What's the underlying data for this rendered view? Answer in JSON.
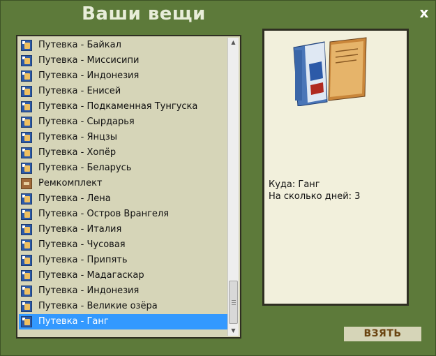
{
  "window": {
    "title": "Ваши вещи",
    "close_label": "x"
  },
  "items": [
    {
      "label": "Путевка - Байкал",
      "icon": "voucher-icon"
    },
    {
      "label": "Путевка - Миссисипи",
      "icon": "voucher-icon"
    },
    {
      "label": "Путевка - Индонезия",
      "icon": "voucher-icon"
    },
    {
      "label": "Путевка - Енисей",
      "icon": "voucher-icon"
    },
    {
      "label": "Путевка - Подкаменная Тунгуска",
      "icon": "voucher-icon"
    },
    {
      "label": "Путевка - Сырдарья",
      "icon": "voucher-icon"
    },
    {
      "label": "Путевка - Янцзы",
      "icon": "voucher-icon"
    },
    {
      "label": "Путевка - Хопёр",
      "icon": "voucher-icon"
    },
    {
      "label": "Путевка - Беларусь",
      "icon": "voucher-icon"
    },
    {
      "label": "Ремкомплект",
      "icon": "repair-kit-icon"
    },
    {
      "label": "Путевка - Лена",
      "icon": "voucher-icon"
    },
    {
      "label": "Путевка - Остров Врангеля",
      "icon": "voucher-icon"
    },
    {
      "label": "Путевка - Италия",
      "icon": "voucher-icon"
    },
    {
      "label": "Путевка - Чусовая",
      "icon": "voucher-icon"
    },
    {
      "label": "Путевка - Припять",
      "icon": "voucher-icon"
    },
    {
      "label": "Путевка - Мадагаскар",
      "icon": "voucher-icon"
    },
    {
      "label": "Путевка - Индонезия",
      "icon": "voucher-icon"
    },
    {
      "label": "Путевка - Великие озёра",
      "icon": "voucher-icon"
    },
    {
      "label": "Путевка - Ганг",
      "icon": "voucher-icon",
      "selected": true
    }
  ],
  "detail": {
    "image": "travel-brochure-image",
    "destination_line": "Куда: Ганг",
    "days_line": "На сколько дней: 3"
  },
  "actions": {
    "take_label": "ВЗЯТЬ"
  },
  "colors": {
    "background": "#5d7a3a",
    "panel": "#d6d5b8",
    "detail_panel": "#f2f0dc",
    "selection": "#3399ff",
    "take_text": "#6a4410"
  }
}
